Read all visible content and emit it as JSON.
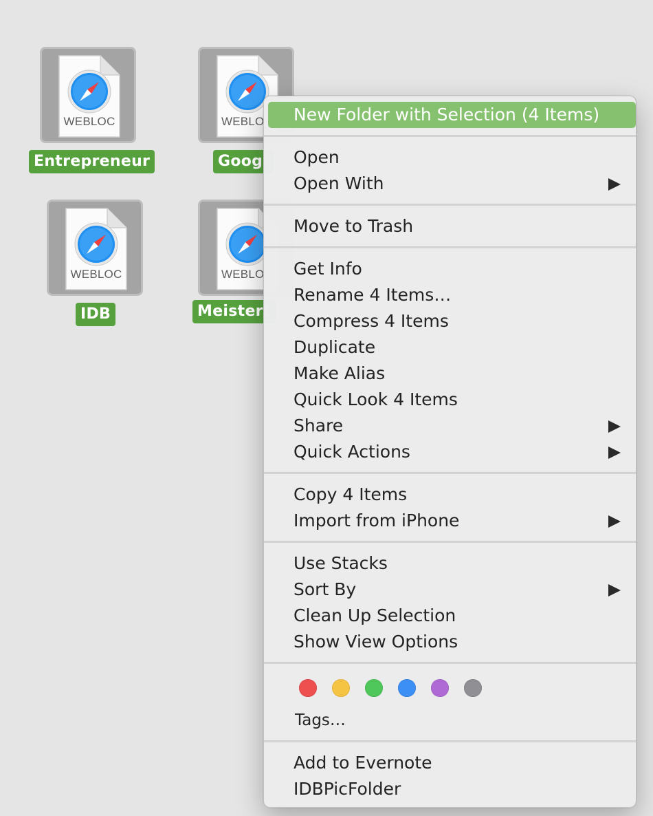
{
  "desktop": {
    "files": [
      {
        "name": "Entrepreneur",
        "type_label": "WEBLOC"
      },
      {
        "name": "Googl",
        "type_label": "WEBLO"
      },
      {
        "name": "IDB",
        "type_label": "WEBLOC"
      },
      {
        "name": "Meistert",
        "type_label": "WEBLO"
      }
    ],
    "selection_color": "#56a13e"
  },
  "context_menu": {
    "highlight_color": "#85c16e",
    "items": [
      {
        "label": "New Folder with Selection (4 Items)",
        "highlighted": true
      },
      {
        "label": "Open"
      },
      {
        "label": "Open With",
        "submenu": true
      },
      {
        "label": "Move to Trash"
      },
      {
        "label": "Get Info"
      },
      {
        "label": "Rename 4 Items…"
      },
      {
        "label": "Compress 4 Items"
      },
      {
        "label": "Duplicate"
      },
      {
        "label": "Make Alias"
      },
      {
        "label": "Quick Look 4 Items"
      },
      {
        "label": "Share",
        "submenu": true
      },
      {
        "label": "Quick Actions",
        "submenu": true
      },
      {
        "label": "Copy 4 Items"
      },
      {
        "label": "Import from iPhone",
        "submenu": true
      },
      {
        "label": "Use Stacks"
      },
      {
        "label": "Sort By",
        "submenu": true
      },
      {
        "label": "Clean Up Selection"
      },
      {
        "label": "Show View Options"
      },
      {
        "label": "Tags…"
      },
      {
        "label": "Add to Evernote"
      },
      {
        "label": "IDBPicFolder"
      }
    ],
    "tag_colors": [
      {
        "name": "red-tag",
        "color": "#ee5050"
      },
      {
        "name": "yellow-tag",
        "color": "#f5c443"
      },
      {
        "name": "green-tag",
        "color": "#4fc75a"
      },
      {
        "name": "blue-tag",
        "color": "#3b8ff5"
      },
      {
        "name": "purple-tag",
        "color": "#b06ad6"
      },
      {
        "name": "gray-tag",
        "color": "#909094"
      }
    ]
  }
}
